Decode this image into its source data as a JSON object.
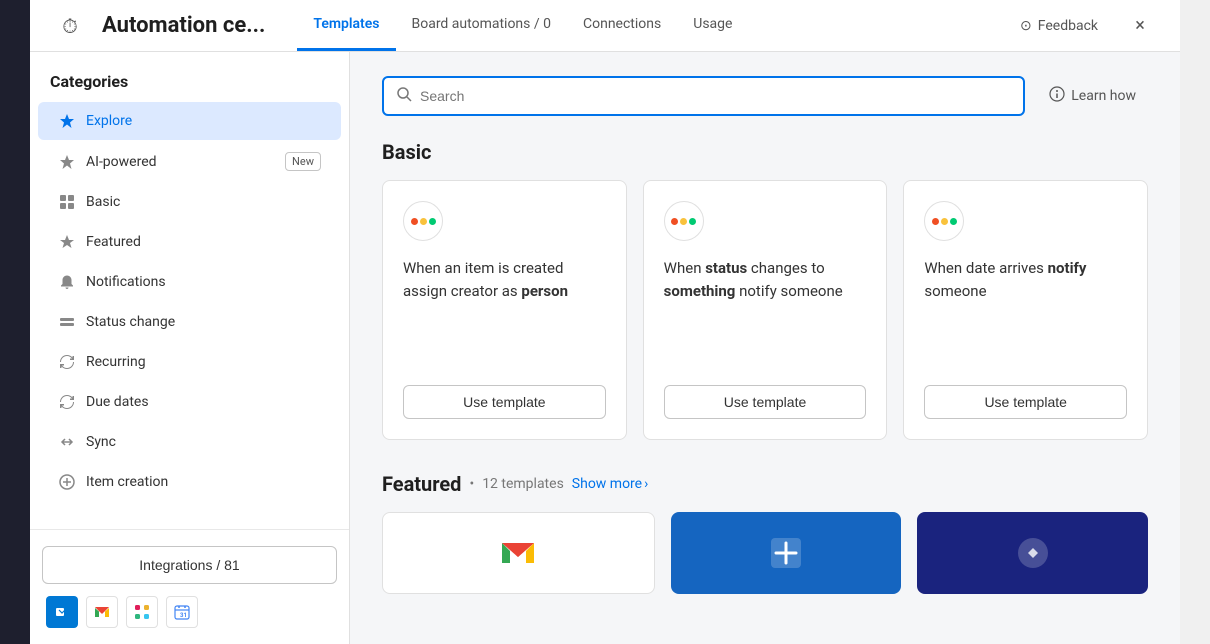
{
  "app": {
    "sidebar_bg": "#1e1f2e"
  },
  "header": {
    "title": "Automation ce...",
    "icon": "⏱",
    "tabs": [
      {
        "label": "Templates",
        "active": true
      },
      {
        "label": "Board automations / 0",
        "active": false
      },
      {
        "label": "Connections",
        "active": false
      },
      {
        "label": "Usage",
        "active": false
      }
    ],
    "feedback_label": "Feedback",
    "close_label": "×"
  },
  "sidebar": {
    "title": "Categories",
    "items": [
      {
        "id": "explore",
        "label": "Explore",
        "icon": "✦",
        "active": true,
        "badge": null
      },
      {
        "id": "ai-powered",
        "label": "AI-powered",
        "icon": "✦",
        "active": false,
        "badge": "New"
      },
      {
        "id": "basic",
        "label": "Basic",
        "icon": "⊞",
        "active": false,
        "badge": null
      },
      {
        "id": "featured",
        "label": "Featured",
        "icon": "◆",
        "active": false,
        "badge": null
      },
      {
        "id": "notifications",
        "label": "Notifications",
        "icon": "🔔",
        "active": false,
        "badge": null
      },
      {
        "id": "status-change",
        "label": "Status change",
        "icon": "⊟",
        "active": false,
        "badge": null
      },
      {
        "id": "recurring",
        "label": "Recurring",
        "icon": "↺",
        "active": false,
        "badge": null
      },
      {
        "id": "due-dates",
        "label": "Due dates",
        "icon": "↺",
        "active": false,
        "badge": null
      },
      {
        "id": "sync",
        "label": "Sync",
        "icon": "↔",
        "active": false,
        "badge": null
      },
      {
        "id": "item-creation",
        "label": "Item creation",
        "icon": "+",
        "active": false,
        "badge": null
      }
    ],
    "integrations_btn": "Integrations / 81"
  },
  "search": {
    "placeholder": "Search"
  },
  "learn_how": "Learn how",
  "basic_section": {
    "title": "Basic",
    "cards": [
      {
        "text_parts": [
          {
            "text": "When an item is created assign creator as ",
            "bold": false
          },
          {
            "text": "person",
            "bold": true
          }
        ],
        "use_template_label": "Use template"
      },
      {
        "text_parts": [
          {
            "text": "When ",
            "bold": false
          },
          {
            "text": "status",
            "bold": true
          },
          {
            "text": " changes to ",
            "bold": false
          },
          {
            "text": "something",
            "bold": true
          },
          {
            "text": " notify someone",
            "bold": false
          }
        ],
        "use_template_label": "Use template"
      },
      {
        "text_parts": [
          {
            "text": "When date arrives ",
            "bold": false
          },
          {
            "text": "notify",
            "bold": true
          },
          {
            "text": " someone",
            "bold": false
          }
        ],
        "use_template_label": "Use template"
      }
    ]
  },
  "featured_section": {
    "title": "Featured",
    "bullet": "•",
    "count": "12 templates",
    "show_more": "Show more",
    "chevron": "›"
  }
}
